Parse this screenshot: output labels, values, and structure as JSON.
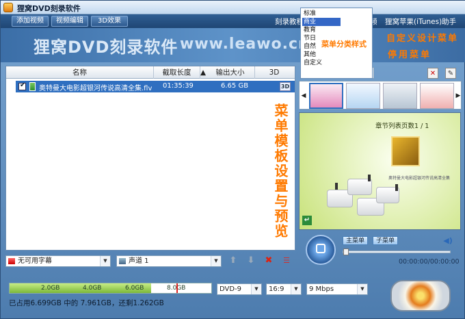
{
  "app": {
    "title": "狸窝DVD刻录软件"
  },
  "menubar": {
    "add_video": "添加视频",
    "video_edit": "视频编辑",
    "effect_3d": "3D效果",
    "links": [
      "刻录教程",
      "频",
      "狸窝苹果(iTunes)助手"
    ]
  },
  "banner": {
    "title": "狸窝DVD刻录软件",
    "url": "www.leawo.cn"
  },
  "table": {
    "columns": [
      "名称",
      "截取长度",
      "输出大小",
      "3D"
    ],
    "rows": [
      {
        "name": "奥特曼大电影超银河传说高清全集.flv",
        "length": "01:35:39",
        "size": "6.65 GB",
        "badge": "3D"
      }
    ]
  },
  "controls": {
    "subtitle": "无可用字幕",
    "audio": "声道 1"
  },
  "menu_template": {
    "category": "商业",
    "options": [
      "标准",
      "商业",
      "教育",
      "节日",
      "自然",
      "其他",
      "自定义"
    ],
    "selected": "商业"
  },
  "preview": {
    "page_title": "章节列表页数1 / 1",
    "subtitle_line": "奥特曼大电影超银河传说高清全集",
    "main_menu": "主菜单",
    "sub_menu": "子菜单",
    "time": "00:00:00/00:00:00"
  },
  "capacity": {
    "ticks": [
      "2.0GB",
      "4.0GB",
      "6.0GB",
      "8.0GB"
    ],
    "used_fraction": 0.7,
    "status": "已占用6.699GB 中的 7.961GB，还剩1.262GB"
  },
  "output": {
    "disc": "DVD-9",
    "aspect": "16:9",
    "bitrate": "9 Mbps"
  },
  "annotations": {
    "category": "菜单分类样式",
    "custom": "自定义设计菜单",
    "disable": "停用菜单",
    "template": "菜单模板设置与预览"
  },
  "colors": {
    "accent": "#ff7a00",
    "selection": "#2f6fc0"
  }
}
